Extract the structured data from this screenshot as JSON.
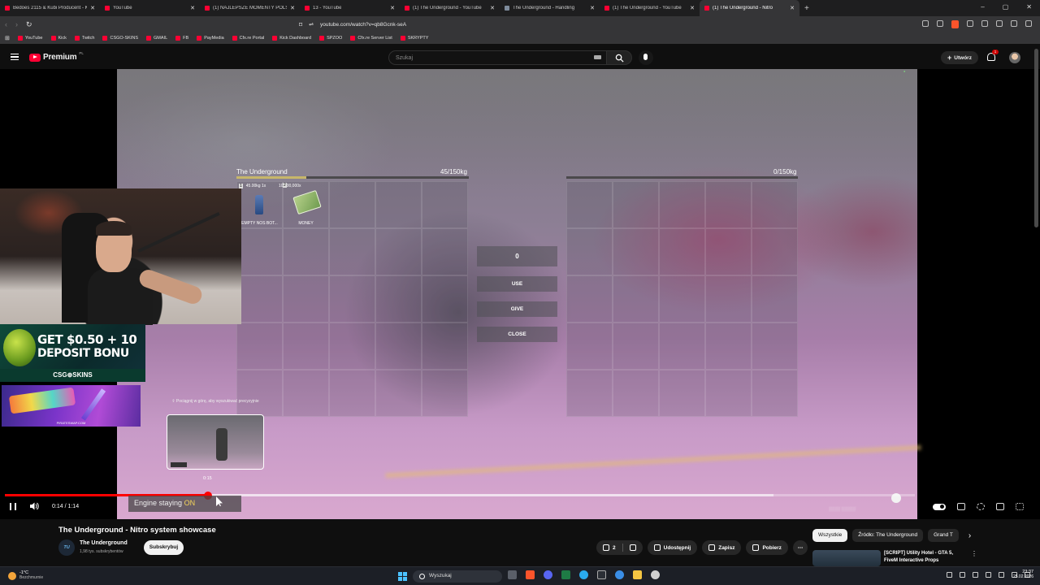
{
  "browser": {
    "tabs": [
      {
        "label": "Bedoes 2115 & Kubi Producent - Ko",
        "icon": "youtube",
        "active": false
      },
      {
        "label": "YouTube",
        "icon": "youtube",
        "active": false
      },
      {
        "label": "(1) NAJLEPSZE MOMENTY POLSKIE",
        "icon": "youtube",
        "active": false
      },
      {
        "label": "13 - YouTube",
        "icon": "youtube",
        "active": false
      },
      {
        "label": "(1) The Underground - YouTube",
        "icon": "youtube",
        "active": false
      },
      {
        "label": "The Underground - Handling",
        "icon": "page",
        "active": false
      },
      {
        "label": "(1) The Underground - YouTube",
        "icon": "youtube",
        "active": false
      },
      {
        "label": "(1) The Underground - Nitro",
        "icon": "youtube",
        "active": true
      }
    ],
    "url": "youtube.com/watch?v=qb8Gcnk-seA",
    "bookmarks": [
      "YouTube",
      "Kick",
      "Twitch",
      "CSGO-SKINS",
      "GMAIL",
      "FB",
      "PayMedia",
      "Cfx.re Portal",
      "Kick Dashboard",
      "SPZOO",
      "Cfx.re Server List",
      "SKRYPTY"
    ]
  },
  "youtube": {
    "logo": "Premium",
    "logo_region": "PL",
    "search_placeholder": "Szukaj",
    "create_label": "Utwórz",
    "notification_count": "1"
  },
  "game": {
    "inventory_title": "The Underground",
    "weight_left": "45/150kg",
    "weight_right": "0/150kg",
    "weight_fill": 0.3,
    "slot1": {
      "num": "1",
      "info": "45.00kg 1x",
      "label": "EMPTY NOS BOT..."
    },
    "slot2": {
      "num": "2",
      "info": "10,000,000x",
      "label": "MONEY"
    },
    "amount": "0",
    "use": "USE",
    "give": "GIVE",
    "close": "CLOSE"
  },
  "overlays": {
    "promo_line1": "GET $0.50 + 10",
    "promo_line2": "DEPOSIT BONU",
    "promo_brand": "CSG⊕SKINS",
    "pirate_site": "PIRATESWAP.COM",
    "hover_tip": "⇧ Pociągnij w górę, aby wyszukiwać precyzyjnie",
    "hover_time": "0:15"
  },
  "player": {
    "time": "0:14 / 1:14",
    "played_fraction": 0.223,
    "buffered_fraction": 0.845,
    "engine_text": "Engine staying",
    "engine_state": "ON"
  },
  "video": {
    "title": "The Underground - Nitro system showcase",
    "channel": "The Underground",
    "channel_avatar": "TU",
    "subscribers": "1,98 tys. subskrybentów",
    "subscribe": "Subskrybuj",
    "likes": "2",
    "share": "Udostępnij",
    "save": "Zapisz",
    "download": "Pobierz"
  },
  "sidebar": {
    "chips": [
      "Wszystkie",
      "Źródło: The Underground",
      "Grand T"
    ],
    "reco_title": "[SCRIPT] Utility Hotel - GTA 5, FiveM Interactive Props"
  },
  "taskbar": {
    "temp": "-1°C",
    "weather": "Bezchmurnie",
    "search": "Wyszukaj",
    "time": "23:37",
    "date": "25.02.2026"
  },
  "colors": {
    "youtube_red": "#ff0033",
    "engine_on": "#f5d65a",
    "progress": "#ff0000"
  }
}
